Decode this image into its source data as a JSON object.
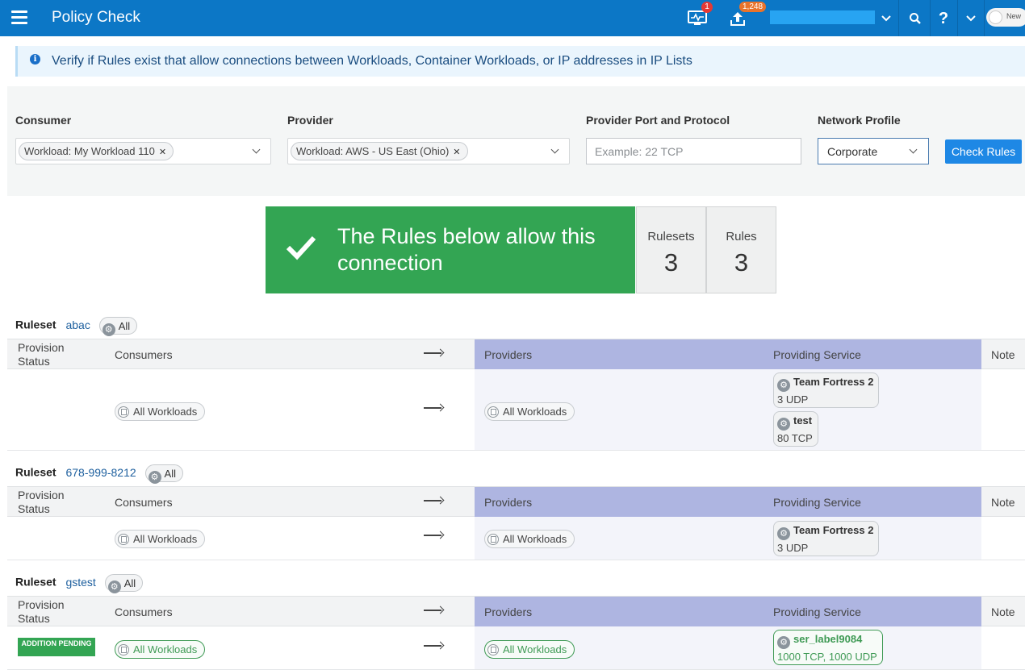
{
  "app": {
    "title": "Policy Check"
  },
  "topbar": {
    "alerts_badge": "1",
    "provision_badge": "1,248",
    "help_label": "?",
    "toggle_label": "New"
  },
  "banner": {
    "text": "Verify if Rules exist that allow connections between Workloads, Container Workloads, or IP addresses in IP Lists"
  },
  "filters": {
    "consumer": {
      "label": "Consumer",
      "chip": "Workload: My Workload 110"
    },
    "provider": {
      "label": "Provider",
      "chip": "Workload: AWS - US East (Ohio)"
    },
    "port": {
      "label": "Provider Port and Protocol",
      "placeholder": "Example: 22 TCP"
    },
    "network_profile": {
      "label": "Network Profile",
      "value": "Corporate"
    },
    "check_button": "Check Rules"
  },
  "result": {
    "message": "The Rules below allow this connection",
    "rulesets_label": "Rulesets",
    "rulesets_count": "3",
    "rules_label": "Rules",
    "rules_count": "3"
  },
  "table_headers": {
    "provision_status": "Provision Status",
    "consumers": "Consumers",
    "providers": "Providers",
    "providing_service": "Providing Service",
    "note": "Note"
  },
  "rulesets": [
    {
      "label": "Ruleset",
      "name": "abac",
      "scope": "All",
      "rows": [
        {
          "status": "",
          "consumer": "All Workloads",
          "provider": "All Workloads",
          "services": [
            {
              "name": "Team Fortress 2",
              "ports": "3 UDP"
            },
            {
              "name": "test",
              "ports": "80 TCP"
            }
          ]
        }
      ]
    },
    {
      "label": "Ruleset",
      "name": "678-999-8212",
      "scope": "All",
      "rows": [
        {
          "status": "",
          "consumer": "All Workloads",
          "provider": "All Workloads",
          "services": [
            {
              "name": "Team Fortress 2",
              "ports": "3 UDP"
            }
          ]
        }
      ]
    },
    {
      "label": "Ruleset",
      "name": "gstest",
      "scope": "All",
      "rows": [
        {
          "status": "ADDITION PENDING",
          "consumer": "All Workloads",
          "provider": "All Workloads",
          "services": [
            {
              "name": "ser_label9084",
              "ports": "1000 TCP, 1000 UDP"
            }
          ]
        }
      ]
    }
  ],
  "colors": {
    "topbar": "#0c77c6",
    "success": "#33a553",
    "providers_header": "#aeb5e1",
    "pending": "#3f9a55"
  }
}
